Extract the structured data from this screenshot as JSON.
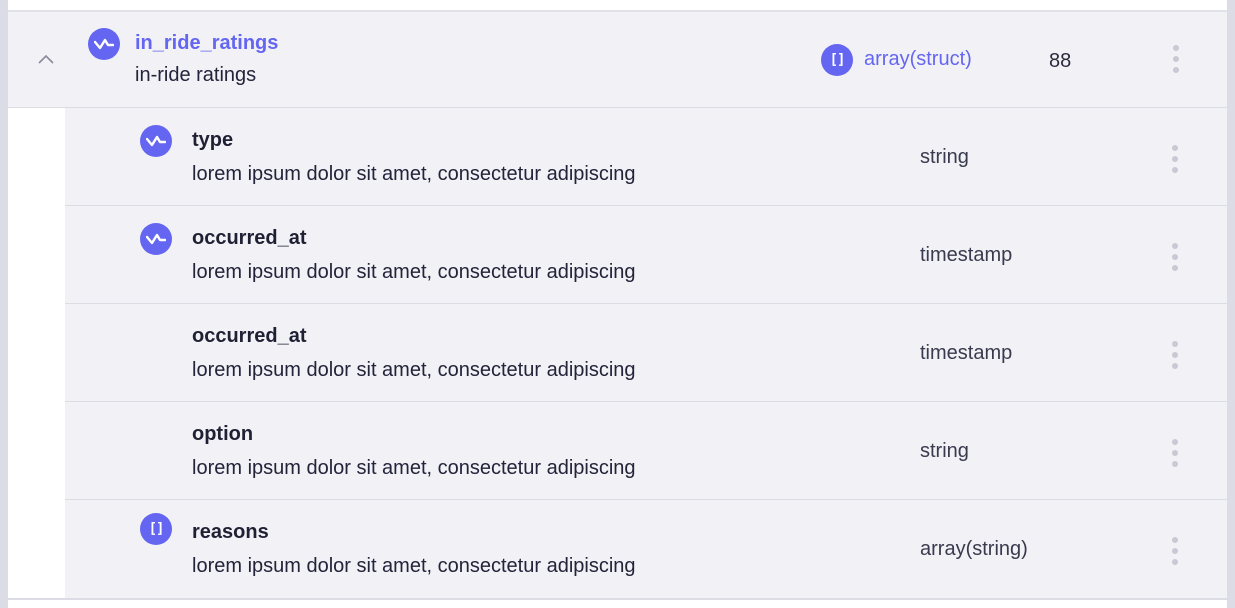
{
  "colors": {
    "accent": "#6466f1",
    "row_bg": "#f1f1f6",
    "divider": "#dcdce5",
    "kebab": "#c9c9d4"
  },
  "parent": {
    "name": "in_ride_ratings",
    "description": "in-ride ratings",
    "type_label": "array(struct)",
    "type_icon": "array-icon",
    "count": "88",
    "icon": "signal-wave-icon",
    "expanded": true
  },
  "children": [
    {
      "name": "type",
      "description": "lorem ipsum dolor sit amet, consectetur adipiscing",
      "type": "string",
      "icon": "signal-wave-icon"
    },
    {
      "name": "occurred_at",
      "description": "lorem ipsum dolor sit amet, consectetur adipiscing",
      "type": "timestamp",
      "icon": "signal-wave-icon"
    },
    {
      "name": "occurred_at",
      "description": "lorem ipsum dolor sit amet, consectetur adipiscing",
      "type": "timestamp",
      "icon": ""
    },
    {
      "name": "option",
      "description": "lorem ipsum dolor sit amet, consectetur adipiscing",
      "type": "string",
      "icon": ""
    },
    {
      "name": "reasons",
      "description": "lorem ipsum dolor sit amet, consectetur adipiscing",
      "type": "array(string)",
      "icon": "array-icon"
    }
  ],
  "array_glyph": "[]"
}
